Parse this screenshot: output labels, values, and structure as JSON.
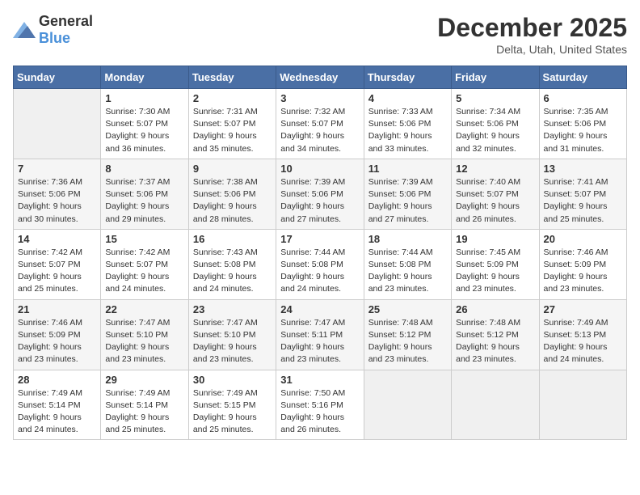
{
  "header": {
    "logo_general": "General",
    "logo_blue": "Blue",
    "title": "December 2025",
    "subtitle": "Delta, Utah, United States"
  },
  "days_of_week": [
    "Sunday",
    "Monday",
    "Tuesday",
    "Wednesday",
    "Thursday",
    "Friday",
    "Saturday"
  ],
  "weeks": [
    [
      {
        "day": "",
        "sunrise": "",
        "sunset": "",
        "daylight": ""
      },
      {
        "day": "1",
        "sunrise": "Sunrise: 7:30 AM",
        "sunset": "Sunset: 5:07 PM",
        "daylight": "Daylight: 9 hours and 36 minutes."
      },
      {
        "day": "2",
        "sunrise": "Sunrise: 7:31 AM",
        "sunset": "Sunset: 5:07 PM",
        "daylight": "Daylight: 9 hours and 35 minutes."
      },
      {
        "day": "3",
        "sunrise": "Sunrise: 7:32 AM",
        "sunset": "Sunset: 5:07 PM",
        "daylight": "Daylight: 9 hours and 34 minutes."
      },
      {
        "day": "4",
        "sunrise": "Sunrise: 7:33 AM",
        "sunset": "Sunset: 5:06 PM",
        "daylight": "Daylight: 9 hours and 33 minutes."
      },
      {
        "day": "5",
        "sunrise": "Sunrise: 7:34 AM",
        "sunset": "Sunset: 5:06 PM",
        "daylight": "Daylight: 9 hours and 32 minutes."
      },
      {
        "day": "6",
        "sunrise": "Sunrise: 7:35 AM",
        "sunset": "Sunset: 5:06 PM",
        "daylight": "Daylight: 9 hours and 31 minutes."
      }
    ],
    [
      {
        "day": "7",
        "sunrise": "Sunrise: 7:36 AM",
        "sunset": "Sunset: 5:06 PM",
        "daylight": "Daylight: 9 hours and 30 minutes."
      },
      {
        "day": "8",
        "sunrise": "Sunrise: 7:37 AM",
        "sunset": "Sunset: 5:06 PM",
        "daylight": "Daylight: 9 hours and 29 minutes."
      },
      {
        "day": "9",
        "sunrise": "Sunrise: 7:38 AM",
        "sunset": "Sunset: 5:06 PM",
        "daylight": "Daylight: 9 hours and 28 minutes."
      },
      {
        "day": "10",
        "sunrise": "Sunrise: 7:39 AM",
        "sunset": "Sunset: 5:06 PM",
        "daylight": "Daylight: 9 hours and 27 minutes."
      },
      {
        "day": "11",
        "sunrise": "Sunrise: 7:39 AM",
        "sunset": "Sunset: 5:06 PM",
        "daylight": "Daylight: 9 hours and 27 minutes."
      },
      {
        "day": "12",
        "sunrise": "Sunrise: 7:40 AM",
        "sunset": "Sunset: 5:07 PM",
        "daylight": "Daylight: 9 hours and 26 minutes."
      },
      {
        "day": "13",
        "sunrise": "Sunrise: 7:41 AM",
        "sunset": "Sunset: 5:07 PM",
        "daylight": "Daylight: 9 hours and 25 minutes."
      }
    ],
    [
      {
        "day": "14",
        "sunrise": "Sunrise: 7:42 AM",
        "sunset": "Sunset: 5:07 PM",
        "daylight": "Daylight: 9 hours and 25 minutes."
      },
      {
        "day": "15",
        "sunrise": "Sunrise: 7:42 AM",
        "sunset": "Sunset: 5:07 PM",
        "daylight": "Daylight: 9 hours and 24 minutes."
      },
      {
        "day": "16",
        "sunrise": "Sunrise: 7:43 AM",
        "sunset": "Sunset: 5:08 PM",
        "daylight": "Daylight: 9 hours and 24 minutes."
      },
      {
        "day": "17",
        "sunrise": "Sunrise: 7:44 AM",
        "sunset": "Sunset: 5:08 PM",
        "daylight": "Daylight: 9 hours and 24 minutes."
      },
      {
        "day": "18",
        "sunrise": "Sunrise: 7:44 AM",
        "sunset": "Sunset: 5:08 PM",
        "daylight": "Daylight: 9 hours and 23 minutes."
      },
      {
        "day": "19",
        "sunrise": "Sunrise: 7:45 AM",
        "sunset": "Sunset: 5:09 PM",
        "daylight": "Daylight: 9 hours and 23 minutes."
      },
      {
        "day": "20",
        "sunrise": "Sunrise: 7:46 AM",
        "sunset": "Sunset: 5:09 PM",
        "daylight": "Daylight: 9 hours and 23 minutes."
      }
    ],
    [
      {
        "day": "21",
        "sunrise": "Sunrise: 7:46 AM",
        "sunset": "Sunset: 5:09 PM",
        "daylight": "Daylight: 9 hours and 23 minutes."
      },
      {
        "day": "22",
        "sunrise": "Sunrise: 7:47 AM",
        "sunset": "Sunset: 5:10 PM",
        "daylight": "Daylight: 9 hours and 23 minutes."
      },
      {
        "day": "23",
        "sunrise": "Sunrise: 7:47 AM",
        "sunset": "Sunset: 5:10 PM",
        "daylight": "Daylight: 9 hours and 23 minutes."
      },
      {
        "day": "24",
        "sunrise": "Sunrise: 7:47 AM",
        "sunset": "Sunset: 5:11 PM",
        "daylight": "Daylight: 9 hours and 23 minutes."
      },
      {
        "day": "25",
        "sunrise": "Sunrise: 7:48 AM",
        "sunset": "Sunset: 5:12 PM",
        "daylight": "Daylight: 9 hours and 23 minutes."
      },
      {
        "day": "26",
        "sunrise": "Sunrise: 7:48 AM",
        "sunset": "Sunset: 5:12 PM",
        "daylight": "Daylight: 9 hours and 23 minutes."
      },
      {
        "day": "27",
        "sunrise": "Sunrise: 7:49 AM",
        "sunset": "Sunset: 5:13 PM",
        "daylight": "Daylight: 9 hours and 24 minutes."
      }
    ],
    [
      {
        "day": "28",
        "sunrise": "Sunrise: 7:49 AM",
        "sunset": "Sunset: 5:14 PM",
        "daylight": "Daylight: 9 hours and 24 minutes."
      },
      {
        "day": "29",
        "sunrise": "Sunrise: 7:49 AM",
        "sunset": "Sunset: 5:14 PM",
        "daylight": "Daylight: 9 hours and 25 minutes."
      },
      {
        "day": "30",
        "sunrise": "Sunrise: 7:49 AM",
        "sunset": "Sunset: 5:15 PM",
        "daylight": "Daylight: 9 hours and 25 minutes."
      },
      {
        "day": "31",
        "sunrise": "Sunrise: 7:50 AM",
        "sunset": "Sunset: 5:16 PM",
        "daylight": "Daylight: 9 hours and 26 minutes."
      },
      {
        "day": "",
        "sunrise": "",
        "sunset": "",
        "daylight": ""
      },
      {
        "day": "",
        "sunrise": "",
        "sunset": "",
        "daylight": ""
      },
      {
        "day": "",
        "sunrise": "",
        "sunset": "",
        "daylight": ""
      }
    ]
  ]
}
